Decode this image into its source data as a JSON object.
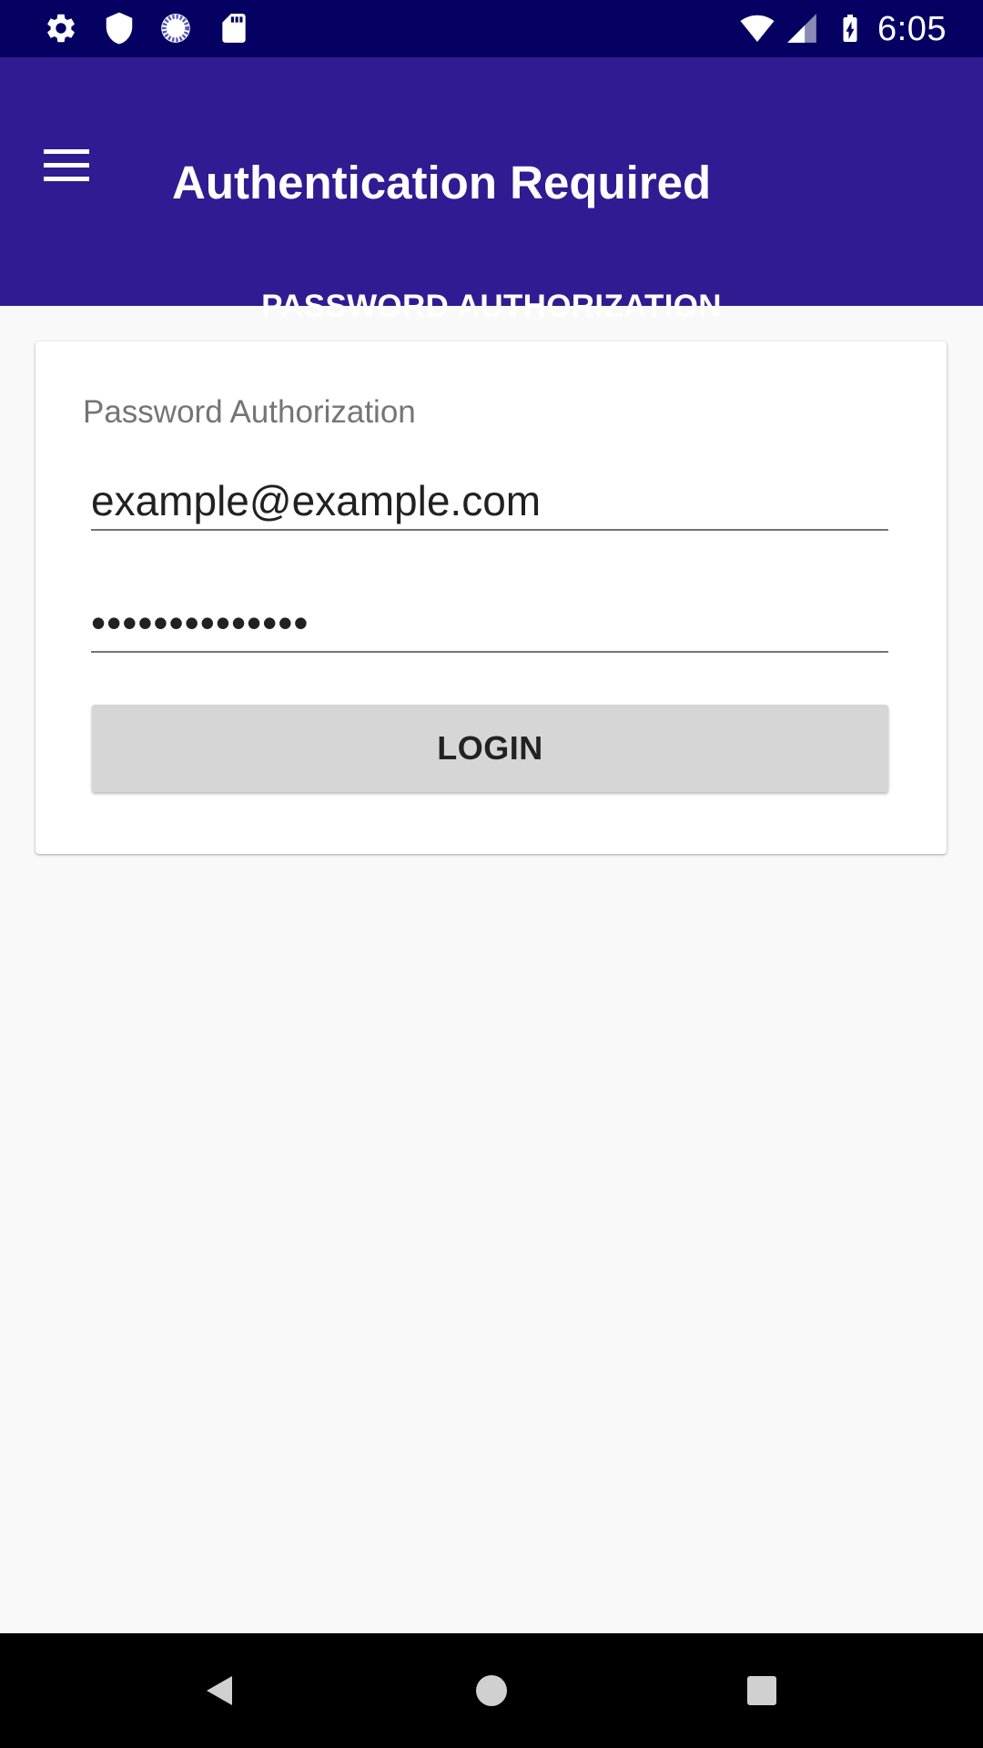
{
  "status_bar": {
    "time": "6:05",
    "left_icons": [
      "settings-icon",
      "shield-icon",
      "sync-icon",
      "sd-card-icon"
    ],
    "right_icons": [
      "wifi-icon",
      "cell-signal-icon",
      "battery-charging-icon"
    ]
  },
  "app_bar": {
    "title": "Authentication Required",
    "menu_icon": "hamburger-menu-icon",
    "color": "#311b92"
  },
  "tabs": [
    {
      "label": "PASSWORD AUTHORIZATION",
      "selected": true
    }
  ],
  "card": {
    "title": "Password Authorization",
    "email": {
      "value": "example@example.com"
    },
    "password": {
      "value": "••••••••••••••"
    },
    "login_label": "LOGIN"
  },
  "nav_bar": {
    "buttons": [
      "back-icon",
      "home-icon",
      "recents-icon"
    ]
  },
  "colors": {
    "status_bar": "#050162",
    "app_bar": "#311b92",
    "background": "#f9f9f9",
    "button": "#d6d6d6"
  }
}
